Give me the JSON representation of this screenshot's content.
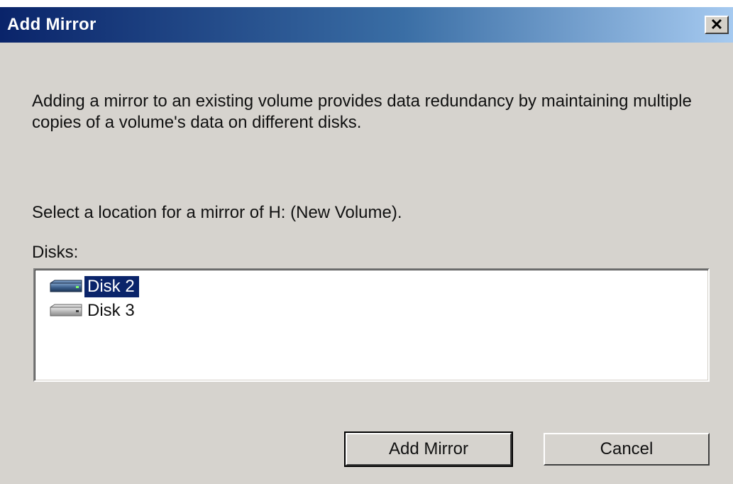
{
  "window": {
    "title": "Add Mirror",
    "close_glyph": "✕"
  },
  "main": {
    "description": "Adding a mirror to an existing volume provides data redundancy by maintaining multiple copies of a volume's data on different disks.",
    "prompt": "Select a location for a mirror of H: (New Volume).",
    "disks_label": "Disks:"
  },
  "disks": [
    {
      "label": "Disk 2",
      "icon": "disk-drive-icon",
      "selected": true
    },
    {
      "label": "Disk 3",
      "icon": "disk-drive-icon",
      "selected": false
    }
  ],
  "buttons": {
    "add_mirror": "Add Mirror",
    "cancel": "Cancel"
  },
  "colors": {
    "titlebar_start": "#0a246a",
    "titlebar_end": "#a6caf0",
    "dialog_background": "#d6d3ce",
    "selection": "#0a246a"
  }
}
